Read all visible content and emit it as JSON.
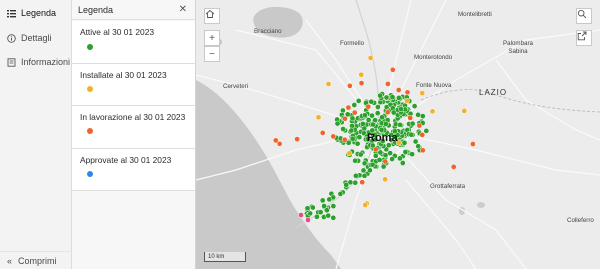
{
  "nav": {
    "items": [
      {
        "label": "Legenda",
        "icon": "list-icon"
      },
      {
        "label": "Dettagli",
        "icon": "info-icon"
      },
      {
        "label": "Informazioni",
        "icon": "book-icon"
      }
    ],
    "collapse_label": "Comprimi"
  },
  "legend": {
    "title": "Legenda",
    "entries": [
      {
        "label": "Attive al 30 01 2023",
        "color": "#2ca02c"
      },
      {
        "label": "Installate al 30 01 2023",
        "color": "#f5b02a"
      },
      {
        "label": "In lavorazione al 30 01 2023",
        "color": "#f0642c"
      },
      {
        "label": "Approvate al 30 01 2023",
        "color": "#2f86eb"
      }
    ]
  },
  "map": {
    "scale_label": "10 km",
    "places": {
      "bracciano": "Bracciano",
      "formello": "Formello",
      "monterotondo": "Monterotondo",
      "montelibretti": "Montelibretti",
      "palombara": "Palombara Sabina",
      "cerveteri": "Cerveteri",
      "fonte_nuova": "Fonte Nuova",
      "lazio": "LAZIO",
      "roma": "Roma",
      "grottaferrata": "Grottaferrata",
      "colleferro": "Colleferro"
    }
  }
}
